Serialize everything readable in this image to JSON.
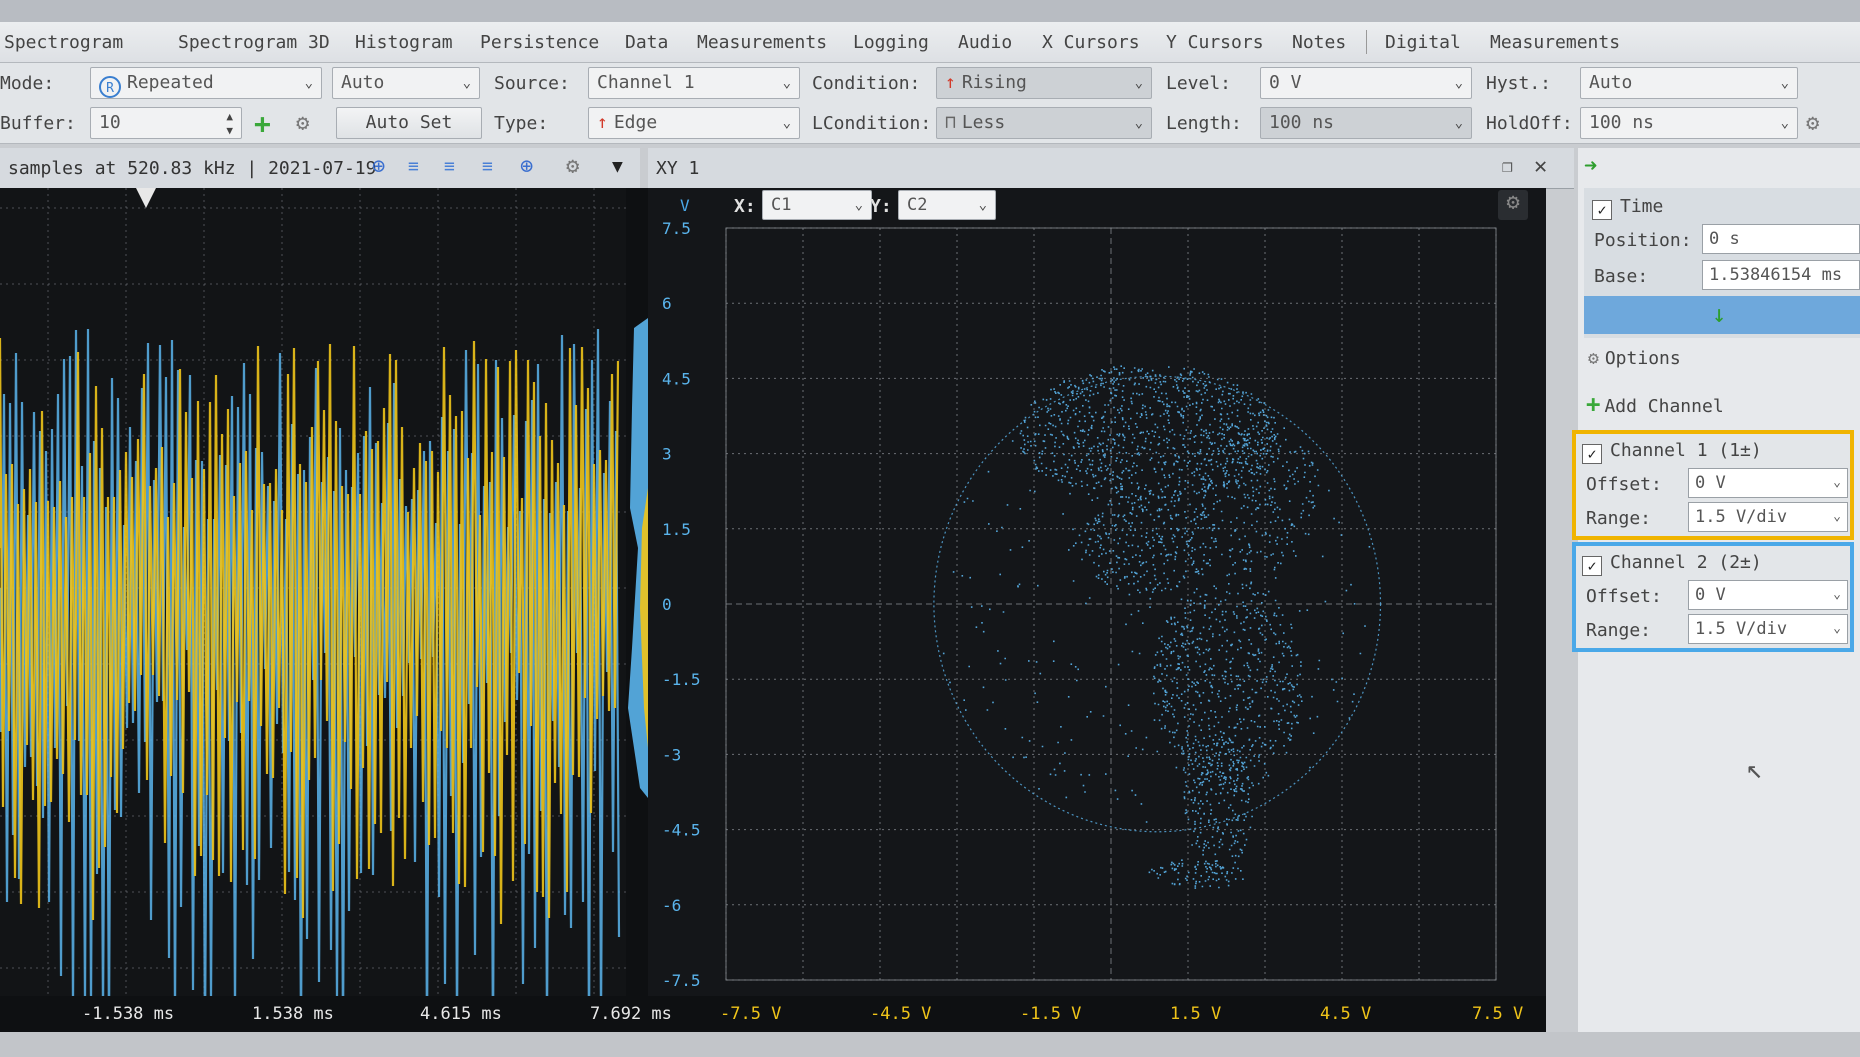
{
  "menu": {
    "items": [
      "Spectrogram",
      "Spectrogram 3D",
      "Histogram",
      "Persistence",
      "Data",
      "Measurements",
      "Logging",
      "Audio",
      "X Cursors",
      "Y Cursors",
      "Notes",
      "Digital",
      "Measurements"
    ]
  },
  "trigger": {
    "mode_label": "Mode:",
    "mode_value": "Repeated",
    "auto_value": "Auto",
    "source_label": "Source:",
    "source_value": "Channel 1",
    "condition_label": "Condition:",
    "condition_value": "Rising",
    "level_label": "Level:",
    "level_value": "0 V",
    "hyst_label": "Hyst.:",
    "hyst_value": "Auto",
    "buffer_label": "Buffer:",
    "buffer_value": "10",
    "autoset_label": "Auto Set",
    "type_label": "Type:",
    "type_value": "Edge",
    "lcondition_label": "LCondition:",
    "lcondition_value": "Less",
    "length_label": "Length:",
    "length_value": "100 ns",
    "holdoff_label": "HoldOff:",
    "holdoff_value": "100 ns"
  },
  "scope": {
    "status": "samples at 520.83 kHz | 2021-07-19",
    "x_ticks": [
      "-1.538 ms",
      "1.538 ms",
      "4.615 ms",
      "7.692 ms"
    ]
  },
  "xy": {
    "title": "XY 1",
    "x_label": "X:",
    "x_value": "C1",
    "y_label": "Y:",
    "y_value": "C2",
    "y_unit": "V",
    "y_ticks": [
      "7.5",
      "6",
      "4.5",
      "3",
      "1.5",
      "0",
      "-1.5",
      "-3",
      "-4.5",
      "-6",
      "-7.5"
    ],
    "x_ticks": [
      "-7.5 V",
      "-4.5 V",
      "-1.5 V",
      "1.5 V",
      "4.5 V",
      "7.5 V"
    ]
  },
  "side": {
    "time_label": "Time",
    "position_label": "Position:",
    "position_value": "0 s",
    "base_label": "Base:",
    "base_value": "1.53846154 ms",
    "options_label": "Options",
    "add_channel_label": "Add Channel",
    "channel1": {
      "title": "Channel 1 (1±)",
      "offset_label": "Offset:",
      "offset_value": "0 V",
      "range_label": "Range:",
      "range_value": "1.5 V/div",
      "color": "#f0b400"
    },
    "channel2": {
      "title": "Channel 2 (2±)",
      "offset_label": "Offset:",
      "offset_value": "0 V",
      "range_label": "Range:",
      "range_value": "1.5 V/div",
      "color": "#4aa8e8"
    }
  },
  "colors": {
    "channel1": "#f0c419",
    "channel2": "#5ab4ec",
    "grid": "#8a8e94"
  }
}
